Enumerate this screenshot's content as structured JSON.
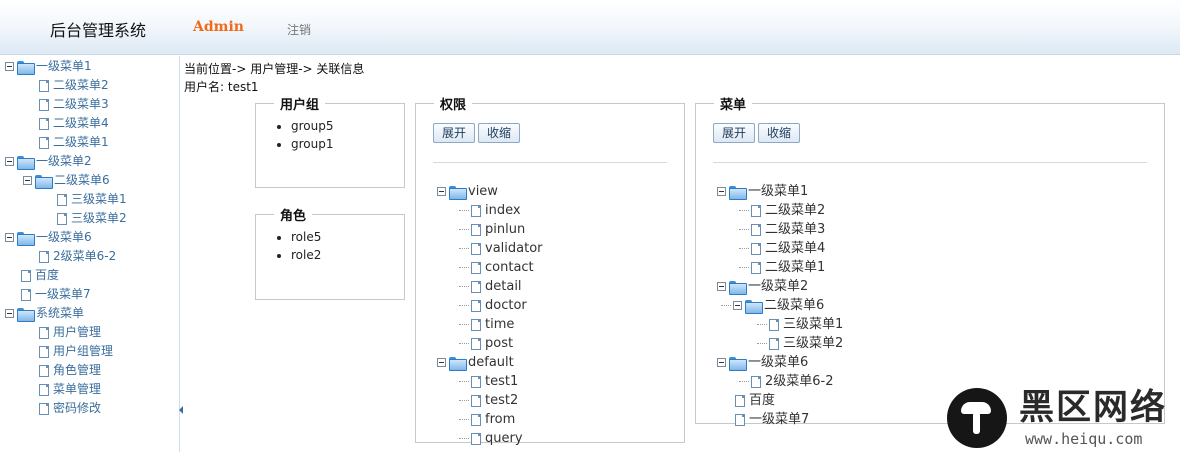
{
  "header": {
    "title": "后台管理系统",
    "user": "Admin",
    "logout_label": "注销"
  },
  "sidebar": {
    "items": [
      {
        "label": "一级菜单1",
        "level": 0,
        "folder": true
      },
      {
        "label": "二级菜单2",
        "level": 1,
        "folder": false
      },
      {
        "label": "二级菜单3",
        "level": 1,
        "folder": false
      },
      {
        "label": "二级菜单4",
        "level": 1,
        "folder": false
      },
      {
        "label": "二级菜单1",
        "level": 1,
        "folder": false
      },
      {
        "label": "一级菜单2",
        "level": 0,
        "folder": true
      },
      {
        "label": "二级菜单6",
        "level": 1,
        "folder": true
      },
      {
        "label": "三级菜单1",
        "level": 2,
        "folder": false
      },
      {
        "label": "三级菜单2",
        "level": 2,
        "folder": false
      },
      {
        "label": "一级菜单6",
        "level": 0,
        "folder": true
      },
      {
        "label": "2级菜单6-2",
        "level": 1,
        "folder": false
      },
      {
        "label": "百度",
        "level": 0,
        "folder": false
      },
      {
        "label": "一级菜单7",
        "level": 0,
        "folder": false
      },
      {
        "label": "系统菜单",
        "level": 0,
        "folder": true
      },
      {
        "label": "用户管理",
        "level": 1,
        "folder": false
      },
      {
        "label": "用户组管理",
        "level": 1,
        "folder": false
      },
      {
        "label": "角色管理",
        "level": 1,
        "folder": false
      },
      {
        "label": "菜单管理",
        "level": 1,
        "folder": false
      },
      {
        "label": "密码修改",
        "level": 1,
        "folder": false
      }
    ]
  },
  "main": {
    "breadcrumb": "当前位置-> 用户管理-> 关联信息",
    "username_label": "用户名: test1",
    "groups": {
      "title": "用户组",
      "items": [
        "group5",
        "group1"
      ]
    },
    "roles": {
      "title": "角色",
      "items": [
        "role5",
        "role2"
      ]
    },
    "permissions": {
      "title": "权限",
      "expand_label": "展开",
      "collapse_label": "收缩",
      "tree": [
        {
          "label": "view",
          "level": 0,
          "folder": true
        },
        {
          "label": "index",
          "level": 1,
          "folder": false
        },
        {
          "label": "pinlun",
          "level": 1,
          "folder": false
        },
        {
          "label": "validator",
          "level": 1,
          "folder": false
        },
        {
          "label": "contact",
          "level": 1,
          "folder": false
        },
        {
          "label": "detail",
          "level": 1,
          "folder": false
        },
        {
          "label": "doctor",
          "level": 1,
          "folder": false
        },
        {
          "label": "time",
          "level": 1,
          "folder": false
        },
        {
          "label": "post",
          "level": 1,
          "folder": false
        },
        {
          "label": "default",
          "level": 0,
          "folder": true
        },
        {
          "label": "test1",
          "level": 1,
          "folder": false
        },
        {
          "label": "test2",
          "level": 1,
          "folder": false
        },
        {
          "label": "from",
          "level": 1,
          "folder": false
        },
        {
          "label": "query",
          "level": 1,
          "folder": false
        }
      ]
    },
    "menus": {
      "title": "菜单",
      "expand_label": "展开",
      "collapse_label": "收缩",
      "tree": [
        {
          "label": "一级菜单1",
          "level": 0,
          "folder": true
        },
        {
          "label": "二级菜单2",
          "level": 1,
          "folder": false
        },
        {
          "label": "二级菜单3",
          "level": 1,
          "folder": false
        },
        {
          "label": "二级菜单4",
          "level": 1,
          "folder": false
        },
        {
          "label": "二级菜单1",
          "level": 1,
          "folder": false
        },
        {
          "label": "一级菜单2",
          "level": 0,
          "folder": true
        },
        {
          "label": "二级菜单6",
          "level": 1,
          "folder": true
        },
        {
          "label": "三级菜单1",
          "level": 2,
          "folder": false
        },
        {
          "label": "三级菜单2",
          "level": 2,
          "folder": false
        },
        {
          "label": "一级菜单6",
          "level": 0,
          "folder": true
        },
        {
          "label": "2级菜单6-2",
          "level": 1,
          "folder": false
        },
        {
          "label": "百度",
          "level": 0,
          "folder": false
        },
        {
          "label": "一级菜单7",
          "level": 0,
          "folder": false
        }
      ]
    }
  },
  "watermark": {
    "text": "黑区网络",
    "url": "www.heiqu.com"
  },
  "colors": {
    "accent_orange": "#f06a1a",
    "link_blue": "#3a6e9e",
    "folder_blue": "#3b8fd8"
  }
}
